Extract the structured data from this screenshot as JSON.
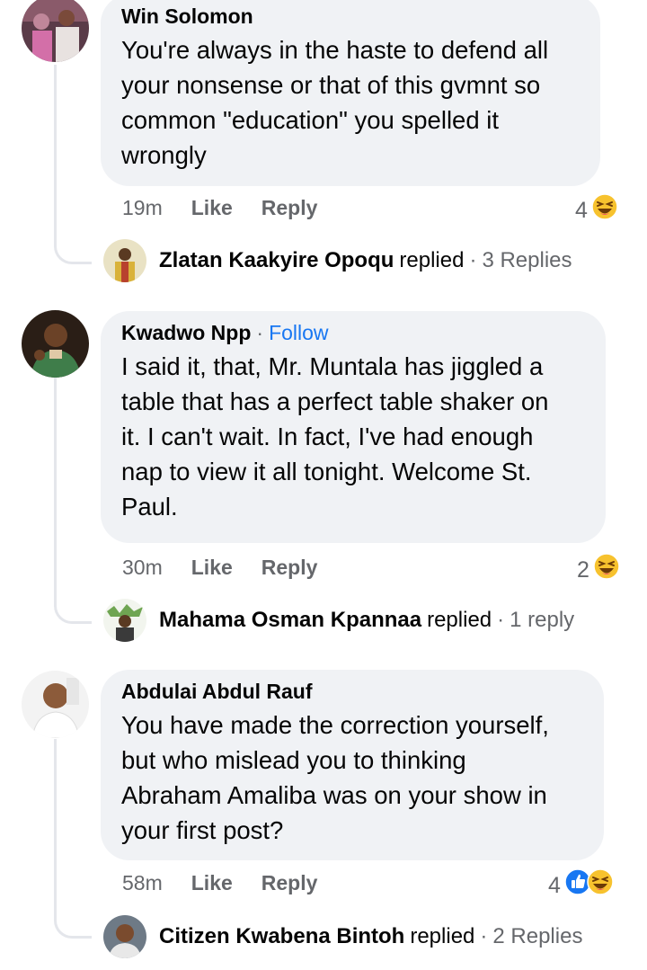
{
  "comments": [
    {
      "author": "Win Solomon",
      "follow": "",
      "text_lines": [
        "You're always in the haste to defend all",
        "your nonsense or that of this gvmnt so",
        "common \"education\" you spelled it",
        "wrongly"
      ],
      "time": "19m",
      "like_label": "Like",
      "reply_label": "Reply",
      "reaction_count": "4",
      "reactions": [
        "haha-emoji-icon"
      ],
      "replier": "Zlatan Kaakyire Opoqu",
      "replied_label": "replied",
      "reply_count": "3 Replies"
    },
    {
      "author": "Kwadwo Npp",
      "follow": "Follow",
      "text_lines": [
        "I said it, that, Mr. Muntala has jiggled a",
        "table that has a perfect table shaker on",
        "it. I can't wait. In fact, I've had enough",
        "nap to view it all tonight. Welcome St.",
        "Paul."
      ],
      "time": "30m",
      "like_label": "Like",
      "reply_label": "Reply",
      "reaction_count": "2",
      "reactions": [
        "haha-emoji-icon"
      ],
      "replier": "Mahama Osman Kpannaa",
      "replied_label": "replied",
      "reply_count": "1 reply"
    },
    {
      "author": "Abdulai Abdul Rauf",
      "follow": "",
      "text_lines": [
        "You have made the correction yourself,",
        "but who mislead you to thinking",
        "Abraham Amaliba was on your show in",
        "your first post?"
      ],
      "time": "58m",
      "like_label": "Like",
      "reply_label": "Reply",
      "reaction_count": "4",
      "reactions": [
        "like-reaction-icon",
        "haha-emoji-icon"
      ],
      "replier": "Citizen Kwabena Bintoh",
      "replied_label": "replied",
      "reply_count": "2 Replies"
    }
  ],
  "colors": {
    "bubble": "#f0f2f5",
    "text": "#050505",
    "muted": "#65676b",
    "link": "#1877f2",
    "thread_line": "#e4e6eb"
  }
}
